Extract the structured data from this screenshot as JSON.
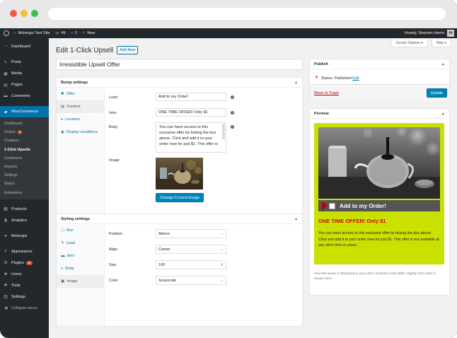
{
  "admin_bar": {
    "site_name": "Molongui Test Site",
    "updates_count": "49",
    "comments_count": "0",
    "new_label": "New",
    "greeting": "Howdy, Stephen Harris",
    "avatar_letter": "m"
  },
  "sidebar": {
    "top_items": [
      {
        "label": "Dashboard",
        "icon": "dashboard-icon"
      },
      {
        "label": "Posts",
        "icon": "pin-icon"
      },
      {
        "label": "Media",
        "icon": "media-icon"
      },
      {
        "label": "Pages",
        "icon": "page-icon"
      },
      {
        "label": "Comments",
        "icon": "comment-icon"
      }
    ],
    "woocommerce_label": "WooCommerce",
    "submenu": [
      {
        "label": "Dashboard"
      },
      {
        "label": "Orders",
        "badge": "2"
      },
      {
        "label": "Coupons"
      },
      {
        "label": "1-Click Upsells"
      },
      {
        "label": "Customers"
      },
      {
        "label": "Reports"
      },
      {
        "label": "Settings"
      },
      {
        "label": "Status"
      },
      {
        "label": "Extensions"
      }
    ],
    "bottom_items": [
      {
        "label": "Products",
        "icon": "products-icon"
      },
      {
        "label": "Analytics",
        "icon": "analytics-icon"
      },
      {
        "label": "Molongui",
        "icon": "molongui-icon"
      },
      {
        "label": "Appearance",
        "icon": "appearance-icon"
      },
      {
        "label": "Plugins",
        "icon": "plugins-icon",
        "badge": "11"
      },
      {
        "label": "Users",
        "icon": "users-icon"
      },
      {
        "label": "Tools",
        "icon": "tools-icon"
      },
      {
        "label": "Settings",
        "icon": "settings-icon"
      },
      {
        "label": "Collapse menu",
        "icon": "collapse-icon"
      }
    ]
  },
  "screen_options_label": "Screen Options ▾",
  "help_label": "Help ▾",
  "page": {
    "title": "Edit 1-Click Upsell",
    "add_new_label": "Add New",
    "post_title": "Irresistible Upsell Offer"
  },
  "bump_settings": {
    "header": "Bump settings",
    "tabs": [
      {
        "label": "Offer",
        "icon": "offer-icon"
      },
      {
        "label": "Content",
        "icon": "content-icon"
      },
      {
        "label": "Location",
        "icon": "location-icon"
      },
      {
        "label": "Display conditions",
        "icon": "display-icon"
      }
    ],
    "lead_label": "Lead",
    "lead_value": "Add to my Order!",
    "intro_label": "Intro",
    "intro_value": "ONE TIME OFFER! Only $1",
    "body_label": "Body",
    "body_value": "You can have access to this exclusive offer by ticking the box above. Click and add it to your order now for just $1. This offer is",
    "image_label": "Image",
    "change_image_label": "Change Current Image"
  },
  "styling_settings": {
    "header": "Styling settings",
    "tabs": [
      {
        "label": "Box",
        "icon": "box-icon"
      },
      {
        "label": "Lead",
        "icon": "lead-icon"
      },
      {
        "label": "Intro",
        "icon": "intro-icon"
      },
      {
        "label": "Body",
        "icon": "body-icon"
      },
      {
        "label": "Image",
        "icon": "image-icon"
      }
    ],
    "position_label": "Position",
    "position_value": "Above",
    "align_label": "Align",
    "align_value": "Center",
    "size_label": "Size",
    "size_value": "100",
    "color_label": "Color",
    "color_value": "Grayscale"
  },
  "publish": {
    "header": "Publish",
    "status_label": "Status: Published",
    "edit_label": "Edit",
    "trash_label": "Move to Trash",
    "update_label": "Update"
  },
  "preview": {
    "header": "Preview",
    "lead": "Add to my Order!",
    "intro": "ONE TIME OFFER! Only $1",
    "body": "You can have access to this exclusive offer by ticking the box above. Click and add it to your order now for just $1. This offer is not available at any other time or place.",
    "note": "How the bump is displayed in your site's frontend could differ slightly from what is shown here."
  },
  "colors": {
    "accent": "#0073aa",
    "bump_background": "#c9e001",
    "bump_intro": "#e3000f",
    "admin_dark": "#23282d"
  }
}
